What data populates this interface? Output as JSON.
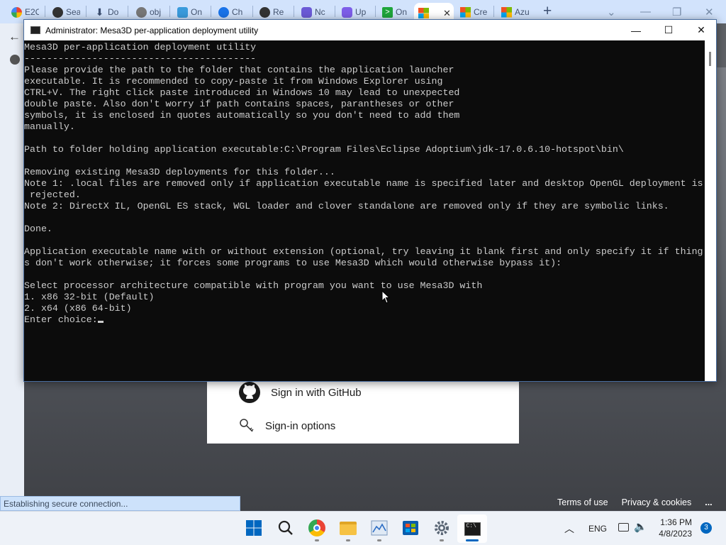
{
  "browser": {
    "tabs": [
      {
        "label": "E2C",
        "icon": "google-icon"
      },
      {
        "label": "Sea",
        "icon": "github-icon"
      },
      {
        "label": "Do",
        "icon": "download-icon"
      },
      {
        "label": "obj",
        "icon": "globe-icon"
      },
      {
        "label": "On",
        "icon": "codeflow-icon"
      },
      {
        "label": "Ch",
        "icon": "chat-icon"
      },
      {
        "label": "Re",
        "icon": "github-icon"
      },
      {
        "label": "Nc",
        "icon": "app-icon"
      },
      {
        "label": "Up",
        "icon": "app-icon"
      },
      {
        "label": "On",
        "icon": "terminal-icon"
      },
      {
        "label": "",
        "icon": "microsoft-icon"
      },
      {
        "label": "Cre",
        "icon": "microsoft-icon"
      },
      {
        "label": "Azu",
        "icon": "microsoft-icon"
      }
    ],
    "new_tab_glyph": "+",
    "status_text": "Establishing secure connection...",
    "accent": "#d2e3fc"
  },
  "signin_panel": {
    "github_label": "Sign in with GitHub",
    "options_label": "Sign-in options"
  },
  "footer": {
    "terms": "Terms of use",
    "privacy": "Privacy & cookies",
    "more": "..."
  },
  "cmd": {
    "title": "Administrator:  Mesa3D per-application deployment utility",
    "lines": [
      "Mesa3D per-application deployment utility",
      "-----------------------------------------",
      "Please provide the path to the folder that contains the application launcher",
      "executable. It is recommended to copy-paste it from Windows Explorer using",
      "CTRL+V. The right click paste introduced in Windows 10 may lead to unexpected",
      "double paste. Also don't worry if path contains spaces, parantheses or other",
      "symbols, it is enclosed in quotes automatically so you don't need to add them",
      "manually.",
      "",
      "Path to folder holding application executable:C:\\Program Files\\Eclipse Adoptium\\jdk-17.0.6.10-hotspot\\bin\\",
      "",
      "Removing existing Mesa3D deployments for this folder...",
      "Note 1: .local files are removed only if application executable name is specified later and desktop OpenGL deployment is",
      " rejected.",
      "Note 2: DirectX IL, OpenGL ES stack, WGL loader and clover standalone are removed only if they are symbolic links.",
      "",
      "Done.",
      "",
      "Application executable name with or without extension (optional, try leaving it blank first and only specify it if thing",
      "s don't work otherwise; it forces some programs to use Mesa3D which would otherwise bypass it):",
      "",
      "Select processor architecture compatible with program you want to use Mesa3D with",
      "1. x86 32-bit (Default)",
      "2. x64 (x86 64-bit)"
    ],
    "prompt": "Enter choice:"
  },
  "taskbar": {
    "language": "ENG",
    "time": "1:36 PM",
    "date": "4/8/2023",
    "notification_count": "3",
    "accent": "#0067c0"
  }
}
